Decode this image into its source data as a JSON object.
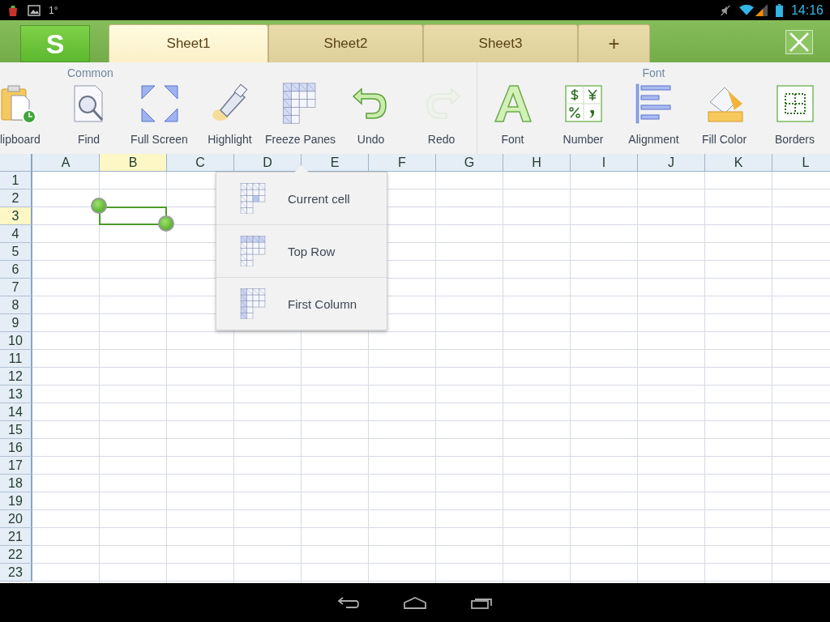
{
  "status_bar": {
    "notification_text": "1°",
    "time": "14:16"
  },
  "header": {
    "logo": "S",
    "add_tab": "+",
    "tabs": [
      {
        "label": "Sheet1",
        "selected": true
      },
      {
        "label": "Sheet2",
        "selected": false
      },
      {
        "label": "Sheet3",
        "selected": false
      }
    ]
  },
  "ribbon": {
    "groups": [
      {
        "label": "Common",
        "tools": [
          {
            "label": "lipboard",
            "kind": "clipboard",
            "disabled": false
          },
          {
            "label": "Find",
            "kind": "find",
            "disabled": false
          },
          {
            "label": "Full Screen",
            "kind": "fullscreen",
            "disabled": false
          },
          {
            "label": "Highlight",
            "kind": "highlight",
            "disabled": false
          },
          {
            "label": "Freeze Panes",
            "kind": "freeze",
            "disabled": false
          },
          {
            "label": "Undo",
            "kind": "undo",
            "disabled": false
          },
          {
            "label": "Redo",
            "kind": "redo",
            "disabled": true
          }
        ]
      },
      {
        "label": "Font",
        "tools": [
          {
            "label": "Font",
            "kind": "font",
            "disabled": false
          },
          {
            "label": "Number",
            "kind": "number",
            "disabled": false
          },
          {
            "label": "Alignment",
            "kind": "alignment",
            "disabled": false
          },
          {
            "label": "Fill Color",
            "kind": "fill",
            "disabled": false
          },
          {
            "label": "Borders",
            "kind": "borders",
            "disabled": false
          }
        ]
      }
    ]
  },
  "sheet": {
    "columns": [
      {
        "label": "A",
        "selected": false
      },
      {
        "label": "B",
        "selected": true
      },
      {
        "label": "C",
        "selected": false
      },
      {
        "label": "D",
        "selected": false
      },
      {
        "label": "E",
        "selected": false
      },
      {
        "label": "F",
        "selected": false
      },
      {
        "label": "G",
        "selected": false
      },
      {
        "label": "H",
        "selected": false
      },
      {
        "label": "I",
        "selected": false
      },
      {
        "label": "J",
        "selected": false
      },
      {
        "label": "K",
        "selected": false
      },
      {
        "label": "L",
        "selected": false
      }
    ],
    "rows": [
      {
        "label": "1",
        "selected": false
      },
      {
        "label": "2",
        "selected": false
      },
      {
        "label": "3",
        "selected": true
      },
      {
        "label": "4",
        "selected": false
      },
      {
        "label": "5",
        "selected": false
      },
      {
        "label": "6",
        "selected": false
      },
      {
        "label": "7",
        "selected": false
      },
      {
        "label": "8",
        "selected": false
      },
      {
        "label": "9",
        "selected": false
      },
      {
        "label": "10",
        "selected": false
      },
      {
        "label": "11",
        "selected": false
      },
      {
        "label": "12",
        "selected": false
      },
      {
        "label": "13",
        "selected": false
      },
      {
        "label": "14",
        "selected": false
      },
      {
        "label": "15",
        "selected": false
      },
      {
        "label": "16",
        "selected": false
      },
      {
        "label": "17",
        "selected": false
      },
      {
        "label": "18",
        "selected": false
      },
      {
        "label": "19",
        "selected": false
      },
      {
        "label": "20",
        "selected": false
      },
      {
        "label": "21",
        "selected": false
      },
      {
        "label": "22",
        "selected": false
      },
      {
        "label": "23",
        "selected": false
      }
    ]
  },
  "freeze_menu": {
    "items": [
      {
        "label": "Current cell",
        "kind": "current-cell"
      },
      {
        "label": "Top Row",
        "kind": "top-row"
      },
      {
        "label": "First Column",
        "kind": "first-column"
      }
    ]
  }
}
